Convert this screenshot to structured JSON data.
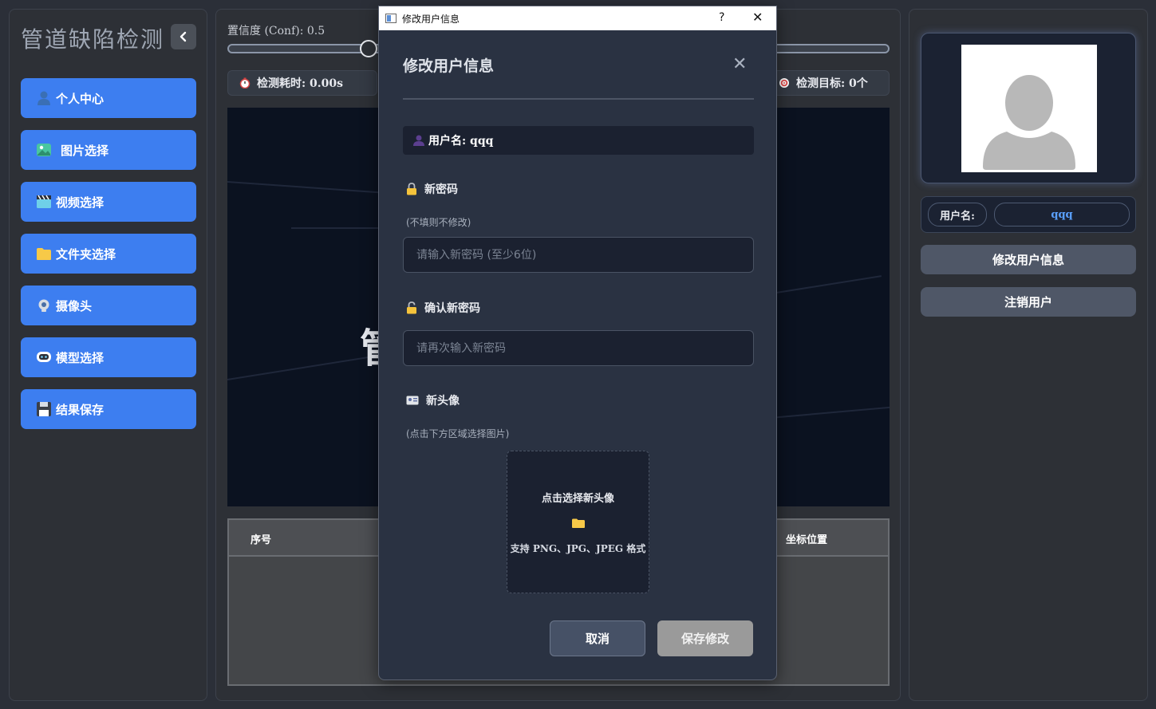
{
  "app": {
    "title": "管道缺陷检测"
  },
  "sidebar": {
    "items": [
      {
        "label": "个人中心",
        "icon": "user-icon"
      },
      {
        "label": "图片选择",
        "icon": "image-icon"
      },
      {
        "label": "视频选择",
        "icon": "clapper-icon"
      },
      {
        "label": "文件夹选择",
        "icon": "folder-icon"
      },
      {
        "label": "摄像头",
        "icon": "webcam-icon"
      },
      {
        "label": "模型选择",
        "icon": "model-icon"
      },
      {
        "label": "结果保存",
        "icon": "floppy-icon"
      }
    ]
  },
  "center": {
    "conf_label": "置信度 (Conf): 0.5",
    "conf_value": 0.5,
    "time_label": "检测耗时: 0.00s",
    "target_label": "检测目标: 0个",
    "display_char": "管",
    "table": {
      "columns": [
        "序号",
        "坐标位置"
      ]
    }
  },
  "right": {
    "username_label": "用户名:",
    "username_value": "qqq",
    "edit_button": "修改用户信息",
    "logout_button": "注销用户"
  },
  "dialog": {
    "window_title": "修改用户信息",
    "help_glyph": "?",
    "close_glyph": "✕",
    "heading": "修改用户信息",
    "username_line": "用户名: qqq",
    "new_password": {
      "label": "新密码",
      "hint": "(不填则不修改)",
      "placeholder": "请输入新密码 (至少6位)"
    },
    "confirm_password": {
      "label": "确认新密码",
      "placeholder": "请再次输入新密码"
    },
    "avatar": {
      "label": "新头像",
      "hint": "(点击下方区域选择图片)",
      "upload_title": "点击选择新头像",
      "upload_formats": "支持 PNG、JPG、JPEG 格式"
    },
    "cancel_button": "取消",
    "save_button": "保存修改"
  },
  "colors": {
    "accent_blue": "#3d7ef0",
    "panel_bg": "#2d3036",
    "dialog_bg": "#2a3242",
    "username_blue": "#5aa0ff"
  }
}
